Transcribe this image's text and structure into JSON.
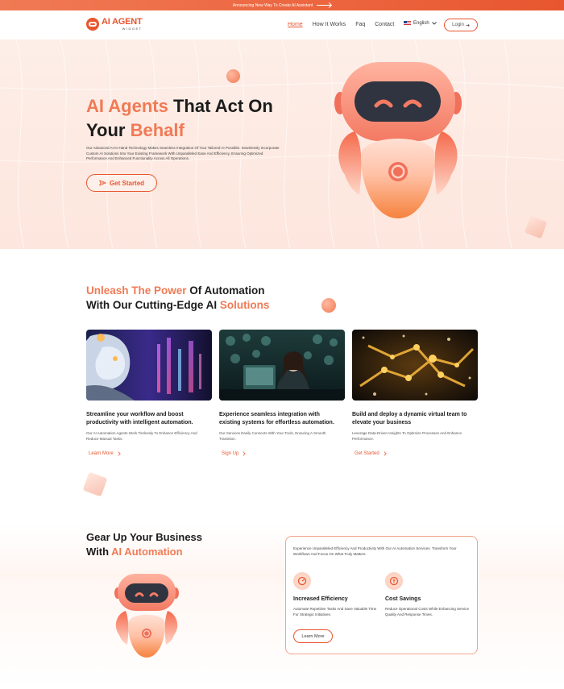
{
  "announcement": {
    "text": "Announcing New Way To Create AI Assistant"
  },
  "brand": {
    "name": "AI AGENT",
    "sub": "WIDGET"
  },
  "nav": {
    "items": [
      {
        "label": "Home",
        "active": true
      },
      {
        "label": "How It Works"
      },
      {
        "label": "Faq"
      },
      {
        "label": "Contact"
      }
    ],
    "language": "English",
    "login": "Login"
  },
  "hero": {
    "title_accent_1": "AI Agents",
    "title_plain_1": " That Act On",
    "title_plain_2": "Your ",
    "title_accent_2": "Behalf",
    "description": "Our Advanced AI-In-Hand Technology Makes Seamless Integration Of Your Tailored AI Possible. Seamlessly Incorporate Custom AI Solutions Into Your Existing Framework With Unparalleled Ease And Efficiency, Ensuring Optimized Performance And Enhanced Functionality Across All Operations.",
    "cta": "Get Started"
  },
  "automation": {
    "title_accent_1": "Unleash The Power",
    "title_plain_1": " Of Automation",
    "title_plain_2": "With Our Cutting-Edge AI ",
    "title_accent_2": "Solutions",
    "cards": [
      {
        "title": "Streamline your workflow and boost productivity with intelligent automation.",
        "description": "Our AI Automation Agents Work Tirelessly To Enhance Efficiency And Reduce Manual Tasks.",
        "link": "Learn More"
      },
      {
        "title": "Experience seamless integration with existing systems for effortless automation.",
        "description": "Our Services Easily Connects With Your Tools, Ensuring A Smooth Transition.",
        "link": "Sign Up"
      },
      {
        "title": "Build and deploy a dynamic virtual team to elevate your business",
        "description": "Leverage Data-Driven Insights To Optimize Processes And Enhance Performance.",
        "link": "Get Started"
      }
    ]
  },
  "gear": {
    "title_plain_1": "Gear Up Your Business",
    "title_plain_2": "With ",
    "title_accent_2": "AI Automation",
    "intro": "Experience Unparalleled Efficiency And Productivity With Our AI Automation Services. Transform Your Workflows And Focus On What Truly Matters.",
    "features": [
      {
        "title": "Increased Efficiency",
        "description": "Automate Repetitive Tasks And Save Valuable Time For Strategic Initiatives."
      },
      {
        "title": "Cost Savings",
        "description": "Reduce Operational Costs While Enhancing Service Quality And Response Times."
      }
    ],
    "button": "Learn More"
  },
  "colors": {
    "accent": "#e8562f",
    "accent_light": "#f07a55",
    "hero_bg": "#fdeee8"
  }
}
